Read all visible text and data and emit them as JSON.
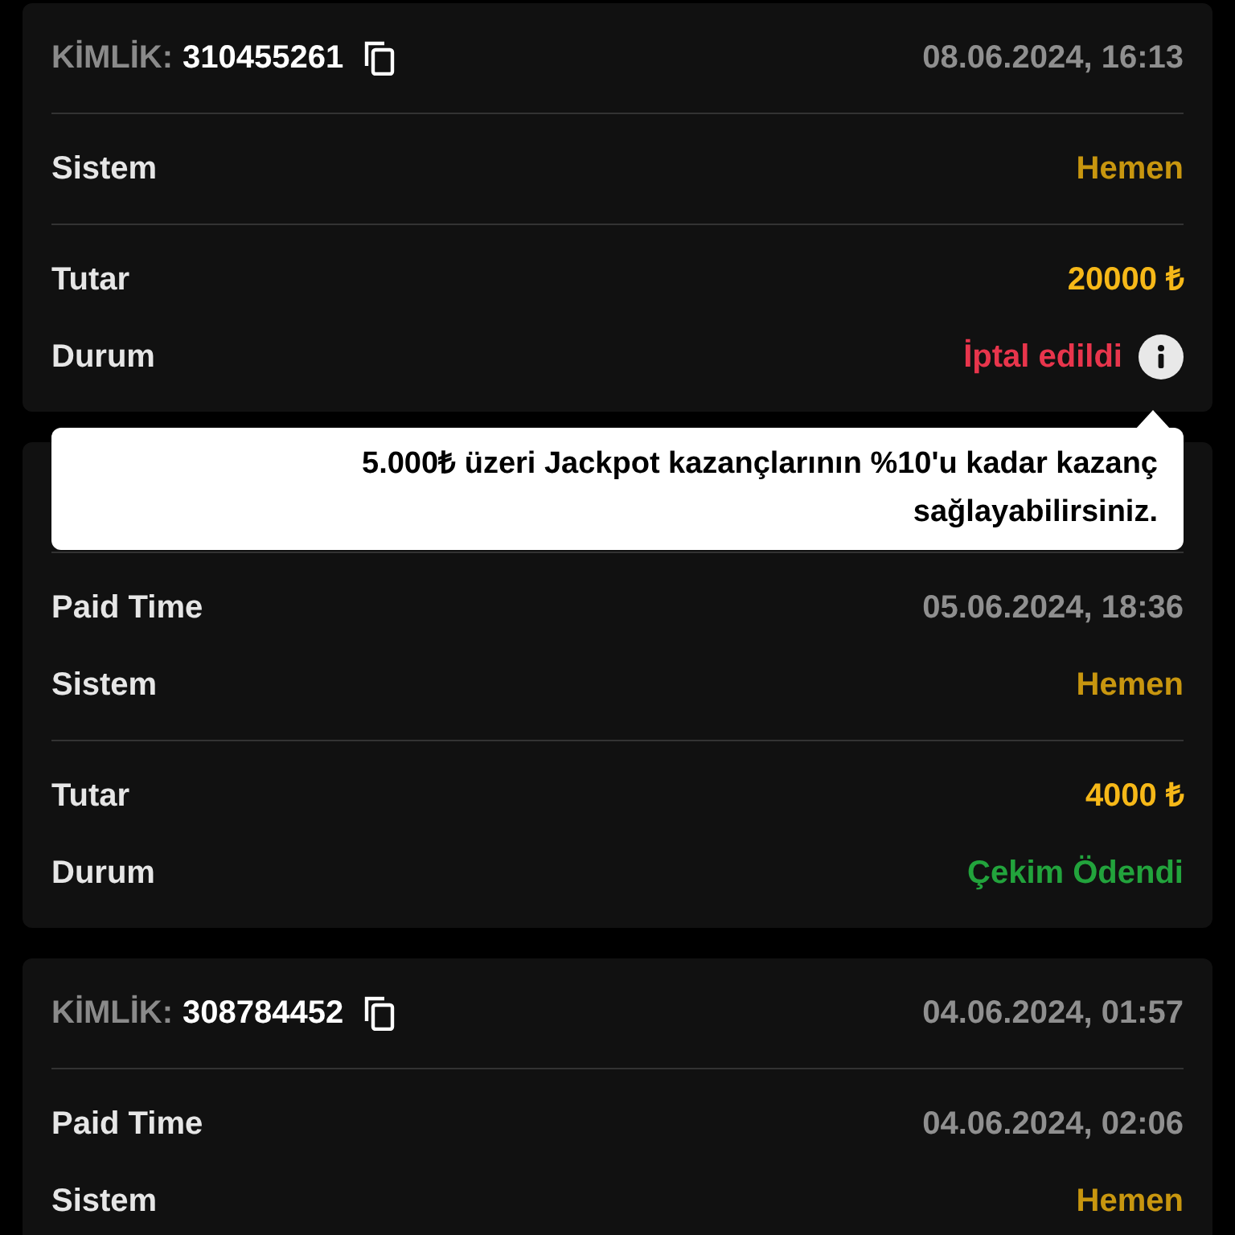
{
  "cards": [
    {
      "header": {
        "label": "KİMLİK:",
        "id": "310455261",
        "date": "08.06.2024, 16:13"
      },
      "sections": [
        [
          {
            "kind": "system",
            "label": "Sistem",
            "value": "Hemen"
          }
        ],
        [
          {
            "kind": "amount",
            "label": "Tutar",
            "value": "20000 ₺"
          },
          {
            "kind": "status",
            "label": "Durum",
            "value": "İptal edildi",
            "color": "#e8354c",
            "info": true
          }
        ]
      ]
    },
    {
      "sections": [
        [
          {
            "kind": "paid_time",
            "label": "Paid Time",
            "value": "05.06.2024, 18:36"
          },
          {
            "kind": "system",
            "label": "Sistem",
            "value": "Hemen"
          }
        ],
        [
          {
            "kind": "amount",
            "label": "Tutar",
            "value": "4000 ₺"
          },
          {
            "kind": "status",
            "label": "Durum",
            "value": "Çekim Ödendi",
            "color": "#22a33c",
            "info": false
          }
        ]
      ]
    },
    {
      "header": {
        "label": "KİMLİK:",
        "id": "308784452",
        "date": "04.06.2024, 01:57"
      },
      "sections": [
        [
          {
            "kind": "paid_time",
            "label": "Paid Time",
            "value": "04.06.2024, 02:06"
          },
          {
            "kind": "system",
            "label": "Sistem",
            "value": "Hemen"
          }
        ]
      ]
    }
  ],
  "tooltip": {
    "text": "5.000₺ üzeri Jackpot kazançlarının %10'u kadar kazanç sağlayabilirsiniz."
  }
}
